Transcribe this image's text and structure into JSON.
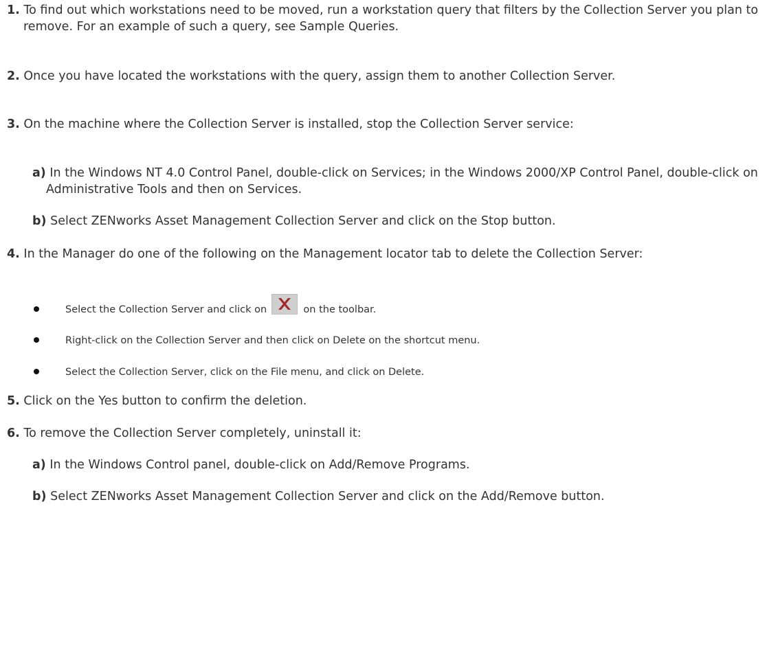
{
  "steps": [
    {
      "number": "1.",
      "text": "To find out which workstations need to be moved, run a workstation query that filters by the Collection Server you plan to remove. For an example of such a query, see Sample Queries."
    },
    {
      "number": "2.",
      "text": "Once you have located the workstations with the query, assign them to another Collection Server."
    },
    {
      "number": "3.",
      "text": "On the machine where the Collection Server is installed, stop the Collection Server service:",
      "substeps": [
        {
          "letter": "a)",
          "text": "In the Windows NT 4.0 Control Panel, double-click on Services; in the Windows 2000/XP Control Panel, double-click on Administrative Tools and then on Services."
        },
        {
          "letter": "b)",
          "text": "Select ZENworks Asset Management Collection Server and click on the Stop button."
        }
      ]
    },
    {
      "number": "4.",
      "text": "In the Manager do one of the following on the Management locator tab to delete the Collection Server:",
      "bullets": [
        {
          "text_before": "Select the Collection Server and click on",
          "icon": "delete-x-icon",
          "text_after": "on the toolbar."
        },
        {
          "text": "Right-click on the Collection Server and then click on Delete on the shortcut menu."
        },
        {
          "text": "Select the Collection Server, click on the File menu, and click on Delete."
        }
      ]
    },
    {
      "number": "5.",
      "text": "Click on the Yes button to confirm the deletion."
    },
    {
      "number": "6.",
      "text": "To remove the Collection Server completely, uninstall it:",
      "substeps": [
        {
          "letter": "a)",
          "text": "In the Windows Control panel, double-click on Add/Remove Programs."
        },
        {
          "letter": "b)",
          "text": "Select ZENworks Asset Management Collection Server and click on the Add/Remove button."
        }
      ]
    }
  ],
  "colors": {
    "text": "#333333",
    "delete_icon": "#a3262a",
    "icon_button_bg": "#cfcfcf"
  }
}
